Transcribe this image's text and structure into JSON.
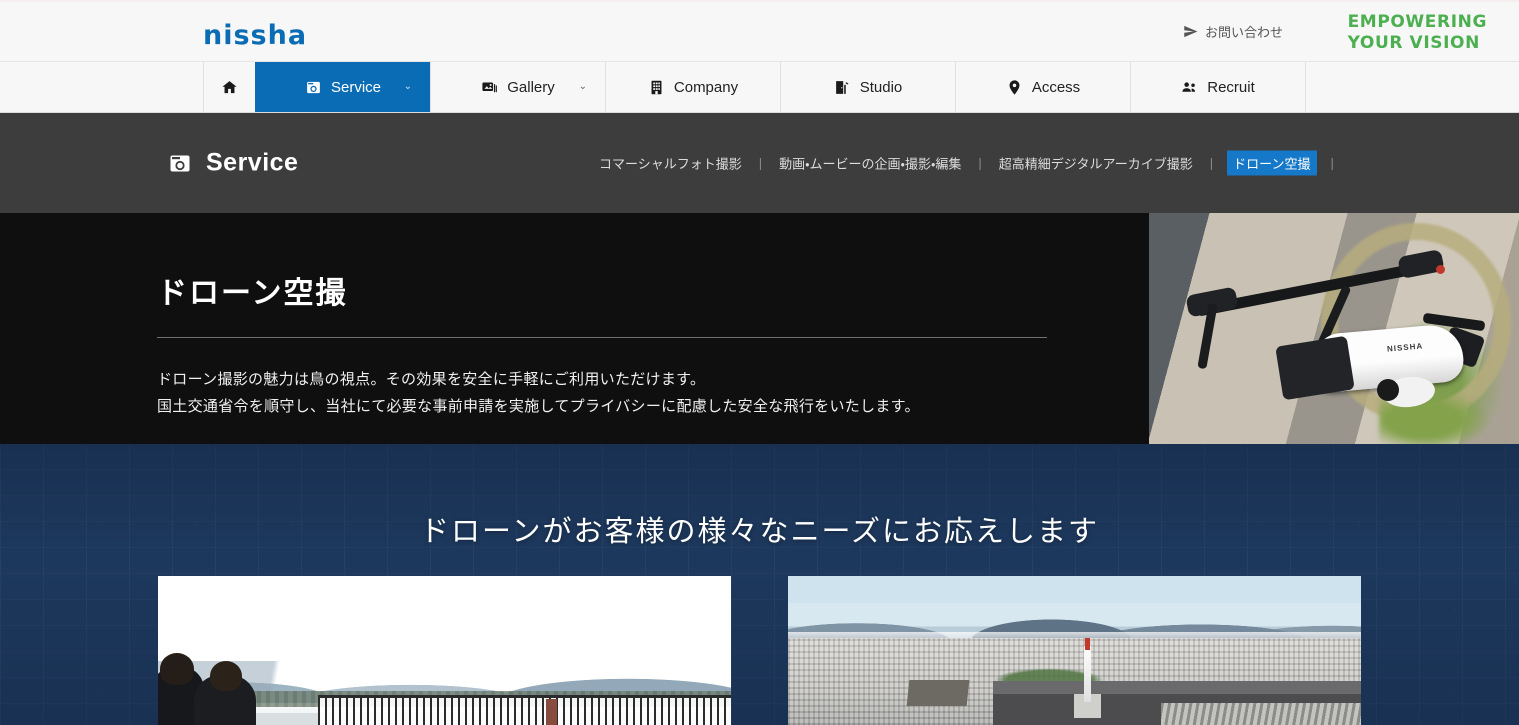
{
  "header": {
    "logo": "nissha",
    "contact_label": "お問い合わせ",
    "contact_icon": "paper-plane-icon",
    "tagline_line1": "EMPOWERING",
    "tagline_line2": "YOUR VISION",
    "tagline_color": "#4caf50",
    "logo_color": "#0a6cb4"
  },
  "nav": {
    "active_color": "#0a6cb4",
    "items": [
      {
        "label": "",
        "icon": "home-icon",
        "active": false,
        "has_chevron": false
      },
      {
        "label": "Service",
        "icon": "camera-icon",
        "active": true,
        "has_chevron": true,
        "chevron": "⌄"
      },
      {
        "label": "Gallery",
        "icon": "images-icon",
        "active": false,
        "has_chevron": true,
        "chevron": "⌄"
      },
      {
        "label": "Company",
        "icon": "building-icon",
        "active": false,
        "has_chevron": false
      },
      {
        "label": "Studio",
        "icon": "studio-door-icon",
        "active": false,
        "has_chevron": false
      },
      {
        "label": "Access",
        "icon": "map-pin-icon",
        "active": false,
        "has_chevron": false
      },
      {
        "label": "Recruit",
        "icon": "users-icon",
        "active": false,
        "has_chevron": false
      }
    ]
  },
  "subnav": {
    "title": "Service",
    "title_icon": "camera-icon",
    "background": "#3d3d3d",
    "current_highlight": "#1678c8",
    "links": [
      {
        "label": "コマーシャルフォト撮影",
        "current": false
      },
      {
        "label": "動画・ムービーの企画・撮影・編集",
        "current": false
      },
      {
        "label": "超高精細デジタルアーカイブ撮影",
        "current": false
      },
      {
        "label": "ドローン空撮",
        "current": true
      }
    ],
    "separator": "|"
  },
  "hero": {
    "title": "ドローン空撮",
    "background": "#0f0f0f",
    "description_line1": "ドローン撮影の魅力は鳥の視点。その効果を安全に手軽にご利用いただけます。",
    "description_line2": "国土交通省令を順守し、当社にて必要な事前申請を実施してプライバシーに配慮した安全な飛行をいたします。",
    "photo_alt": "white-drone-photo"
  },
  "promo": {
    "background": "#1e3a5f",
    "heading": "ドローンがお客様の様々なニーズにお応えします",
    "cards": [
      {
        "alt": "drone-operators-at-lakeside-photo"
      },
      {
        "alt": "aerial-view-of-kyoto-city-photo"
      }
    ]
  }
}
